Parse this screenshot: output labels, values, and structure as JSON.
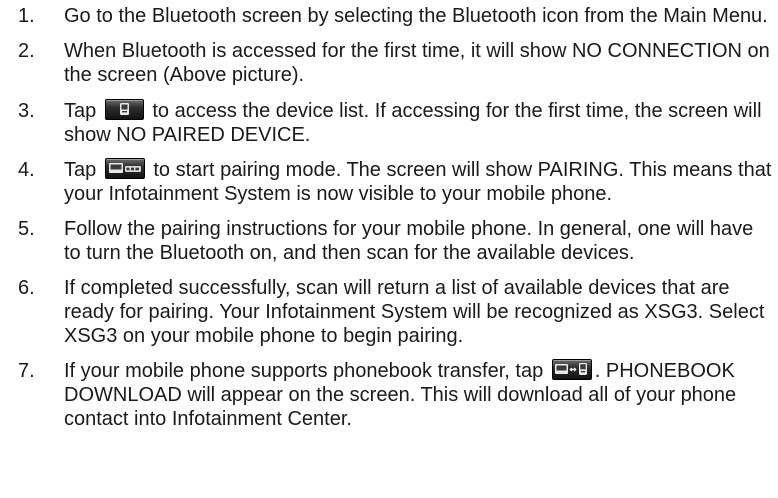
{
  "steps": [
    {
      "number": "1.",
      "text": "Go to the Bluetooth screen by selecting the Bluetooth icon from the Main Menu."
    },
    {
      "number": "2.",
      "text": "When Bluetooth is accessed for the first time, it will show NO CONNECTION on the screen (Above picture)."
    },
    {
      "number": "3.",
      "before": "Tap",
      "icon": "phone-device-list-icon",
      "after": "to access the device list. If accessing for the first time, the screen will show NO PAIRED DEVICE."
    },
    {
      "number": "4.",
      "before": "Tap",
      "icon": "new-pairing-icon",
      "after": "to start pairing mode. The screen will show PAIRING. This means that your Infotainment System is now visible to your mobile phone."
    },
    {
      "number": "5.",
      "text": "Follow the pairing instructions for your mobile phone. In general, one will have to turn the Bluetooth on, and then scan for the available devices."
    },
    {
      "number": "6.",
      "text": "If completed successfully, scan will return a list of available devices that are ready for pairing. Your Infotainment System will be recognized as XSG3. Select XSG3 on your mobile phone to begin pairing."
    },
    {
      "number": "7.",
      "before": "If your mobile phone supports phonebook transfer, tap",
      "icon": "phonebook-transfer-icon",
      "after": ". PHONEBOOK DOWNLOAD will appear on the screen. This will download all of your phone contact into Infotainment Center."
    }
  ]
}
